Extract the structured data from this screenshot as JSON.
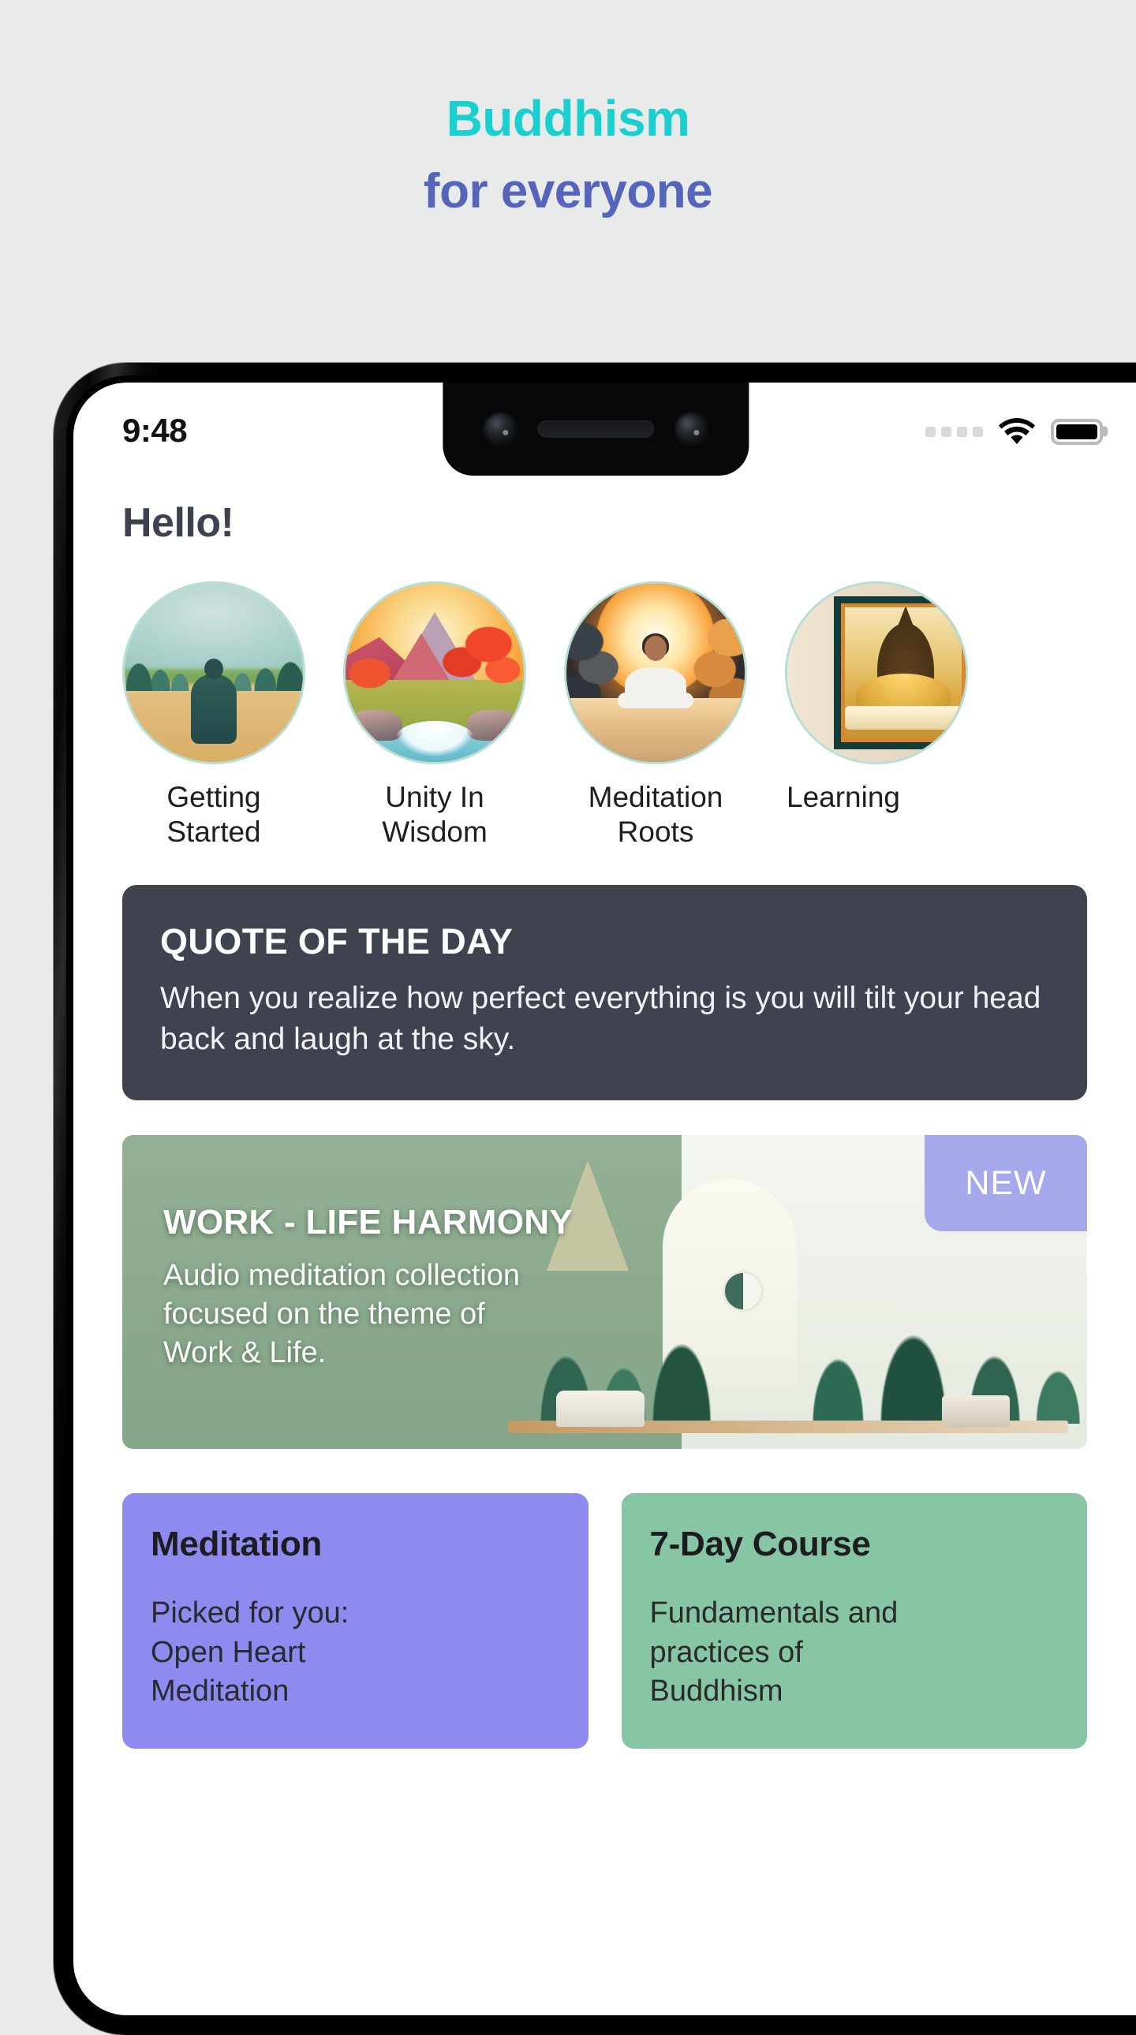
{
  "hero": {
    "line1": "Buddhism",
    "line2": "for everyone",
    "color_line1": "#19cfd0",
    "color_line2": "#5565bc",
    "background": "#e9eaea"
  },
  "phone": {
    "status_bar": {
      "time": "9:48",
      "signal_icon": "signal-dots-icon",
      "wifi_icon": "wifi-icon",
      "battery_icon": "battery-full-icon",
      "battery_level": "100"
    },
    "notch": {
      "camera_left_icon": "camera-icon",
      "speaker_icon": "earpiece-speaker-icon",
      "camera_right_icon": "camera-icon"
    }
  },
  "app": {
    "greeting": "Hello!",
    "categories": [
      {
        "label": "Getting\nStarted",
        "art": "monk-walking-path-image"
      },
      {
        "label": "Unity In\nWisdom",
        "art": "autumn-mountain-river-image"
      },
      {
        "label": "Meditation\nRoots",
        "art": "person-meditating-sunrise-image"
      },
      {
        "label": "Learning",
        "art": "golden-buddha-painting-image"
      }
    ],
    "quote_card": {
      "title": "QUOTE OF THE DAY",
      "text": "When you realize how perfect everything is you will tilt your head back and laugh at the sky.",
      "background": "#3f424f"
    },
    "promo": {
      "title": "WORK - LIFE HARMONY",
      "subtitle": "Audio meditation collection\nfocused on the theme of\nWork & Life.",
      "badge": "NEW",
      "badge_color": "#a5a8ea",
      "background": "#8aab8c"
    },
    "tiles": [
      {
        "title": "Meditation",
        "description": "Picked for you:\nOpen Heart\nMeditation",
        "background": "#8e8af0"
      },
      {
        "title": "7-Day Course",
        "description": "Fundamentals and\npractices of\nBuddhism",
        "background": "#86c6a5"
      }
    ]
  }
}
